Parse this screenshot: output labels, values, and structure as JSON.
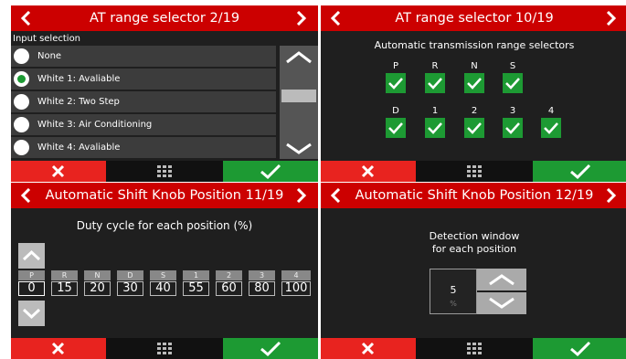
{
  "panel1": {
    "title": "AT range selector 2/19",
    "section_label": "Input selection",
    "items": [
      {
        "label": "None",
        "selected": false
      },
      {
        "label": "White 1: Avaliable",
        "selected": true
      },
      {
        "label": "White 2: Two Step",
        "selected": false
      },
      {
        "label": "White 3: Air Conditioning",
        "selected": false
      },
      {
        "label": "White 4: Avaliable",
        "selected": false
      }
    ]
  },
  "panel2": {
    "title": "AT range selector 10/19",
    "subtitle": "Automatic transmission range selectors",
    "selectors_row1": [
      {
        "label": "P",
        "checked": true
      },
      {
        "label": "R",
        "checked": true
      },
      {
        "label": "N",
        "checked": true
      },
      {
        "label": "S",
        "checked": true
      }
    ],
    "selectors_row2": [
      {
        "label": "D",
        "checked": true
      },
      {
        "label": "1",
        "checked": true
      },
      {
        "label": "2",
        "checked": true
      },
      {
        "label": "3",
        "checked": true
      },
      {
        "label": "4",
        "checked": true
      }
    ]
  },
  "panel3": {
    "title": "Automatic Shift Knob Position 11/19",
    "subtitle": "Duty cycle for each position (%)",
    "positions": [
      {
        "label": "P",
        "value": "0"
      },
      {
        "label": "R",
        "value": "15"
      },
      {
        "label": "N",
        "value": "20"
      },
      {
        "label": "D",
        "value": "30"
      },
      {
        "label": "S",
        "value": "40"
      },
      {
        "label": "1",
        "value": "55"
      },
      {
        "label": "2",
        "value": "60"
      },
      {
        "label": "3",
        "value": "80"
      },
      {
        "label": "4",
        "value": "100"
      }
    ]
  },
  "panel4": {
    "title": "Automatic Shift Knob Position 12/19",
    "subtitle_line1": "Detection window",
    "subtitle_line2": "for each position",
    "value": "5",
    "unit": "%"
  },
  "colors": {
    "header_red": "#cc0000",
    "cancel_red": "#e8231f",
    "confirm_green": "#1d9a33",
    "panel_bg": "#1f1f1f"
  },
  "icons": {
    "prev": "chevron-left-icon",
    "next": "chevron-right-icon",
    "cancel": "x-icon",
    "menu": "grid-icon",
    "confirm": "checkmark-icon"
  }
}
